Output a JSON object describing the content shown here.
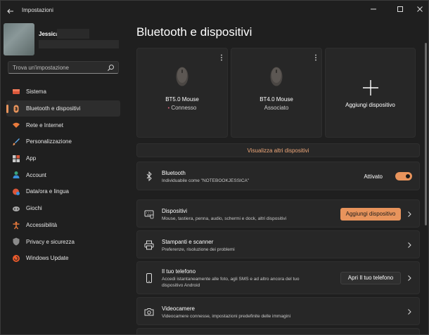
{
  "window": {
    "title": "Impostazioni"
  },
  "user": {
    "name": "Jessica"
  },
  "search": {
    "placeholder": "Trova un'impostazione"
  },
  "sidebar": {
    "items": [
      {
        "label": "Sistema",
        "icon": "monitor-icon"
      },
      {
        "label": "Bluetooth e dispositivi",
        "icon": "bluetooth-icon",
        "active": true
      },
      {
        "label": "Rete e Internet",
        "icon": "wifi-icon"
      },
      {
        "label": "Personalizzazione",
        "icon": "brush-icon"
      },
      {
        "label": "App",
        "icon": "apps-icon"
      },
      {
        "label": "Account",
        "icon": "person-icon"
      },
      {
        "label": "Data/ora e lingua",
        "icon": "globe-clock-icon"
      },
      {
        "label": "Giochi",
        "icon": "gamepad-icon"
      },
      {
        "label": "Accessibilità",
        "icon": "accessibility-icon"
      },
      {
        "label": "Privacy e sicurezza",
        "icon": "shield-icon"
      },
      {
        "label": "Windows Update",
        "icon": "update-icon"
      }
    ]
  },
  "main": {
    "title": "Bluetooth e dispositivi",
    "devices": [
      {
        "name": "BT5.0 Mouse",
        "status": "Connesso"
      },
      {
        "name": "BT4.0 Mouse",
        "status": "Associato"
      }
    ],
    "add_device_label": "Aggiungi dispositivo",
    "show_more": "Visualizza altri dispositivi",
    "bluetooth": {
      "title": "Bluetooth",
      "subtitle": "Individuabile come \"NOTEBOOKJESSICA\"",
      "toggle_label": "Attivato",
      "toggle_on": true
    },
    "rows": {
      "devices": {
        "title": "Dispositivi",
        "subtitle": "Mouse, tastiera, penna, audio, schermi e dock, altri dispositivi",
        "button": "Aggiungi dispositivo"
      },
      "printers": {
        "title": "Stampanti e scanner",
        "subtitle": "Preferenze, risoluzione dei problemi"
      },
      "phone": {
        "title": "Il tuo telefono",
        "subtitle1": "Accedi istantaneamente alle foto, agli SMS e ad altro ancora del tuo",
        "subtitle2": "dispositivo Android",
        "button": "Apri Il tuo telefono"
      },
      "cameras": {
        "title": "Videocamere",
        "subtitle": "Videocamere connesse, impostazioni predefinite delle immagini"
      }
    }
  },
  "colors": {
    "accent": "#e8945c",
    "background": "#1f1f1f",
    "card": "#272727"
  }
}
